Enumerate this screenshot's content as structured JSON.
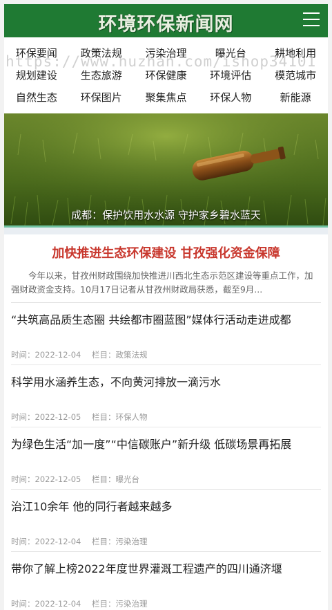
{
  "site": {
    "logo_text": "环境环保新闻网"
  },
  "nav": {
    "rows": [
      [
        "环保要闻",
        "政策法规",
        "污染治理",
        "曝光台",
        "耕地利用"
      ],
      [
        "规划建设",
        "生态旅游",
        "环保健康",
        "环境评估",
        "模范城市"
      ],
      [
        "自然生态",
        "环保图片",
        "聚集焦点",
        "环保人物",
        "新能源"
      ]
    ]
  },
  "watermark": "https://www.huzhan.com/ishop34101",
  "banner": {
    "caption": "成都：保护饮用水水源 守护家乡碧水蓝天"
  },
  "headline": {
    "title": "加快推进生态环保建设 甘孜强化资金保障",
    "summary": "今年以来，甘孜州财政围绕加快推进川西北生态示范区建设等重点工作，加强财政资金支持。10月17日记者从甘孜州财政局获悉，截至9月..."
  },
  "news": [
    {
      "title": "“共筑高品质生态圈 共绘都市圈蓝图”媒体行活动走进成都",
      "time_label": "时间：",
      "time": "2022-12-04",
      "column_label": "栏目：",
      "column": "政策法规"
    },
    {
      "title": "科学用水涵养生态，不向黄河排放一滴污水",
      "time_label": "时间：",
      "time": "2022-12-05",
      "column_label": "栏目：",
      "column": "环保人物"
    },
    {
      "title": "为绿色生活“加一度”“中信碳账户”新升级 低碳场景再拓展",
      "time_label": "时间：",
      "time": "2022-12-05",
      "column_label": "栏目：",
      "column": "曝光台"
    },
    {
      "title": "治江10余年 他的同行者越来越多",
      "time_label": "时间：",
      "time": "2022-12-04",
      "column_label": "栏目：",
      "column": "污染治理"
    },
    {
      "title": "带你了解上榜2022年度世界灌溉工程遗产的四川通济堰",
      "time_label": "时间：",
      "time": "2022-12-04",
      "column_label": "栏目：",
      "column": "污染治理"
    }
  ],
  "colors": {
    "header": "#1f7a33",
    "headline": "#c8372d"
  },
  "icons": {
    "menu": "menu-icon"
  }
}
